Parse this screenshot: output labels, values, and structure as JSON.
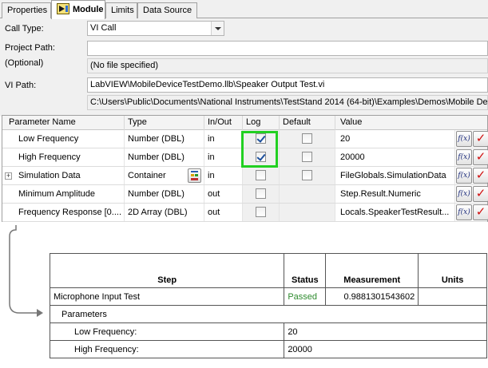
{
  "tabs": [
    {
      "label": "Properties"
    },
    {
      "label": "Module"
    },
    {
      "label": "Limits"
    },
    {
      "label": "Data Source"
    }
  ],
  "form": {
    "call_type_label": "Call Type:",
    "call_type_value": "VI Call",
    "project_path_label": "Project Path:",
    "optional_label": "(Optional)",
    "project_path_value": "",
    "project_path_status": "(No file specified)",
    "vi_path_label": "VI Path:",
    "vi_path_value": "LabVIEW\\MobileDeviceTestDemo.llb\\Speaker Output Test.vi",
    "vi_path_full": "C:\\Users\\Public\\Documents\\National Instruments\\TestStand 2014 (64-bit)\\Examples\\Demos\\Mobile Devi"
  },
  "grid": {
    "headers": {
      "name": "Parameter Name",
      "type": "Type",
      "inout": "In/Out",
      "log": "Log",
      "default": "Default",
      "value": "Value"
    },
    "rows": [
      {
        "name": "Low Frequency",
        "type": "Number (DBL)",
        "inout": "in",
        "log": true,
        "default": false,
        "value": "20"
      },
      {
        "name": "High Frequency",
        "type": "Number (DBL)",
        "inout": "in",
        "log": true,
        "default": false,
        "value": "20000"
      },
      {
        "name": "Simulation Data",
        "type": "Container",
        "inout": "in",
        "log": false,
        "default": false,
        "value": "FileGlobals.SimulationData"
      },
      {
        "name": "Minimum Amplitude",
        "type": "Number (DBL)",
        "inout": "out",
        "log": false,
        "default": null,
        "value": "Step.Result.Numeric"
      },
      {
        "name": "Frequency Response [0....",
        "type": "2D Array (DBL)",
        "inout": "out",
        "log": false,
        "default": null,
        "value": "Locals.SpeakerTestResult..."
      }
    ],
    "expand_glyph": "+",
    "fx_label": "f(x)",
    "check_glyph": "✓"
  },
  "report": {
    "headers": {
      "step": "Step",
      "status": "Status",
      "measurement": "Measurement",
      "units": "Units"
    },
    "step_name": "Microphone Input Test",
    "status": "Passed",
    "measurement": "0.9881301543602",
    "units": "",
    "parameters_label": "Parameters",
    "params": [
      {
        "name": "Low Frequency:",
        "value": "20"
      },
      {
        "name": "High Frequency:",
        "value": "20000"
      }
    ]
  },
  "colors": {
    "highlight": "#22d022",
    "passed": "#2e8b2e",
    "check": "#d01010"
  }
}
